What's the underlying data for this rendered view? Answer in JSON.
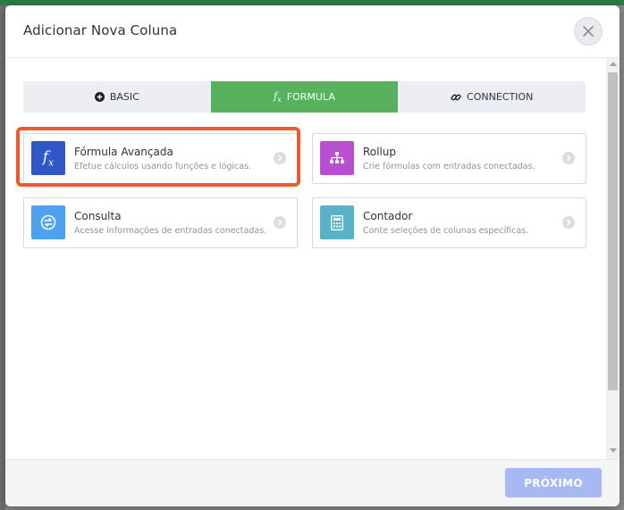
{
  "modal": {
    "title": "Adicionar Nova Coluna",
    "close_icon": "close-icon"
  },
  "tabs": [
    {
      "label": "BASIC",
      "icon": "plus-circle-icon",
      "active": false
    },
    {
      "label": "FORMULA",
      "icon": "fx-icon",
      "active": true
    },
    {
      "label": "CONNECTION",
      "icon": "link-icon",
      "active": false
    }
  ],
  "cards": [
    {
      "title": "Fórmula Avançada",
      "description": "Efetue cálculos usando funções e lógicas.",
      "icon": "fx-icon",
      "icon_color": "#2f57c8",
      "highlighted": true
    },
    {
      "title": "Rollup",
      "description": "Crie fórmulas com entradas conectadas.",
      "icon": "hierarchy-icon",
      "icon_color": "#b74fd0",
      "highlighted": false
    },
    {
      "title": "Consulta",
      "description": "Acesse informações de entradas conectadas.",
      "icon": "lookup-icon",
      "icon_color": "#4da1ee",
      "highlighted": false
    },
    {
      "title": "Contador",
      "description": "Conte seleções de colunas específicas.",
      "icon": "calculator-icon",
      "icon_color": "#5ab2c6",
      "highlighted": false
    }
  ],
  "footer": {
    "next_label": "PRÓXIMO"
  },
  "colors": {
    "active_tab": "#56b25c",
    "highlight_border": "#ee5a2c",
    "next_button": "#a8b8f4"
  }
}
